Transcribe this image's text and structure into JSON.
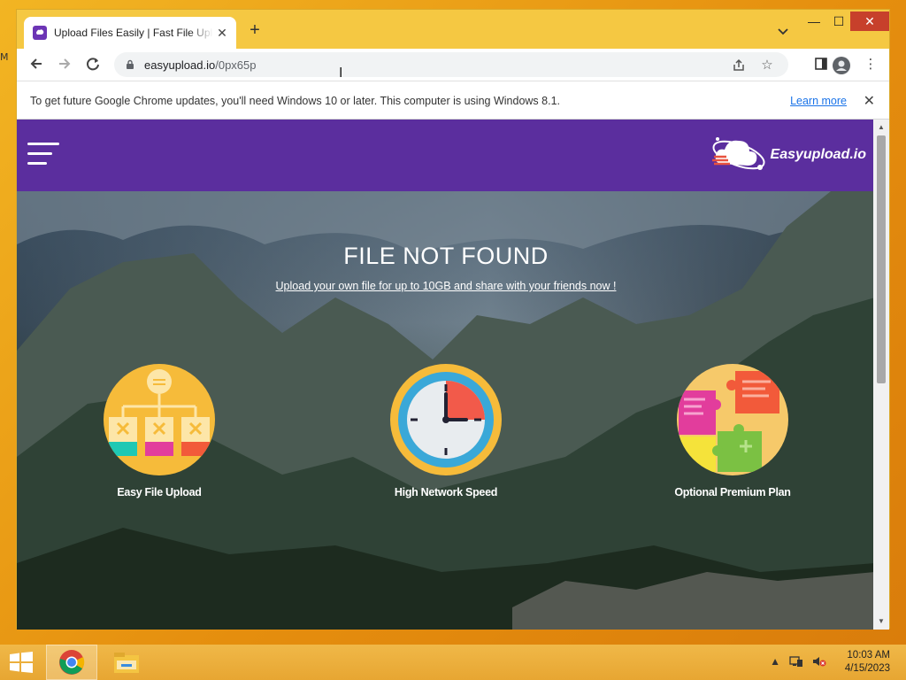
{
  "desktop": {
    "edge_label": "M"
  },
  "browser": {
    "tab": {
      "title": "Upload Files Easily | Fast File Upload",
      "close": "✕"
    },
    "new_tab": "+",
    "window_controls": {
      "minimize": "—",
      "maximize": "☐",
      "close": "✕"
    },
    "address": {
      "host": "easyupload.io",
      "path": "/0px65p"
    },
    "infobar": {
      "message": "To get future Google Chrome updates, you'll need Windows 10 or later. This computer is using Windows 8.1.",
      "link": "Learn more",
      "close": "✕"
    }
  },
  "site": {
    "logo_text": "Easyupload.io",
    "hero": {
      "title": "FILE NOT FOUND",
      "subtitle": "Upload your own file for up to 10GB and share with your friends now !"
    },
    "features": [
      {
        "label": "Easy File Upload",
        "icon": "org-chart-icon"
      },
      {
        "label": "High Network Speed",
        "icon": "clock-icon"
      },
      {
        "label": "Optional Premium Plan",
        "icon": "puzzle-icon"
      }
    ]
  },
  "taskbar": {
    "clock": {
      "time": "10:03 AM",
      "date": "4/15/2023"
    }
  },
  "colors": {
    "site_header": "#5b2e9e",
    "accent_orange": "#f5c842",
    "link_blue": "#1a73e8"
  }
}
